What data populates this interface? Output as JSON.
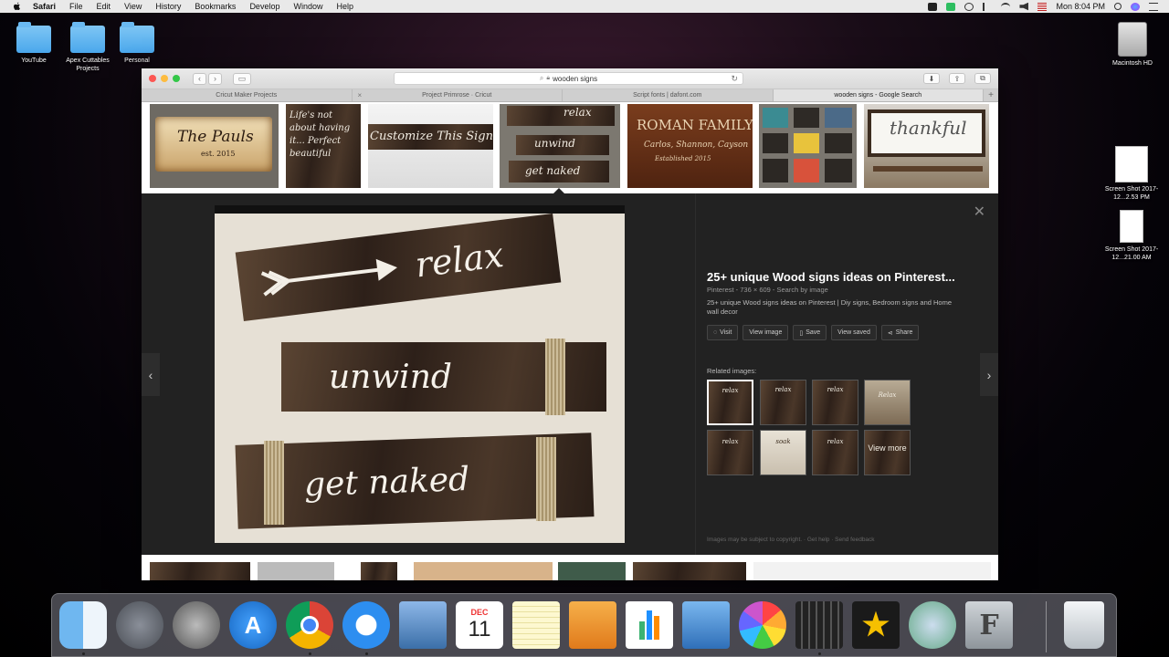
{
  "menubar": {
    "app_name": "Safari",
    "items": [
      "File",
      "Edit",
      "View",
      "History",
      "Bookmarks",
      "Develop",
      "Window",
      "Help"
    ],
    "clock": "Mon 8:04 PM"
  },
  "desktop": {
    "icons_left": [
      {
        "label": "YouTube"
      },
      {
        "label": "Apex Cuttables Projects"
      },
      {
        "label": "Personal"
      }
    ],
    "hd_label": "Macintosh HD",
    "screenshots": [
      {
        "label": "Screen Shot 2017-12...2.53 PM"
      },
      {
        "label": "Screen Shot 2017-12...21.00 AM"
      }
    ]
  },
  "browser": {
    "address": "wooden signs",
    "tabs": [
      {
        "label": "Cricut Maker Projects"
      },
      {
        "label": "Project Primrose · Cricut"
      },
      {
        "label": "Script fonts | dafont.com"
      },
      {
        "label": "wooden signs - Google Search"
      }
    ]
  },
  "thumbs": {
    "t1_line1": "The Pauls",
    "t1_line2": "est. 2015",
    "t2": "Life's not about having it... Perfect beautiful",
    "t3": "Customize This Sign",
    "t4_a": "relax",
    "t4_b": "unwind",
    "t4_c": "get naked",
    "t5_line1": "ROMAN FAMILY",
    "t5_line2": "Carlos, Shannon, Cayson",
    "t5_line3": "Established 2015",
    "t7": "thankful"
  },
  "main_image": {
    "line1": "relax",
    "line2": "unwind",
    "line3": "get naked"
  },
  "result": {
    "title": "25+ unique Wood signs ideas on Pinterest...",
    "meta": "Pinterest - 736 × 609 - Search by image",
    "description": "25+ unique Wood signs ideas on Pinterest | Diy signs, Bedroom signs and Home wall decor",
    "actions": [
      "Visit",
      "View image",
      "Save",
      "View saved",
      "Share"
    ],
    "related_label": "Related images:",
    "related": [
      {
        "t": "relax"
      },
      {
        "t": "relax"
      },
      {
        "t": "relax"
      },
      {
        "t": "Relax"
      },
      {
        "t": "relax"
      },
      {
        "t": "soak"
      },
      {
        "t": "relax"
      },
      {
        "t": "View more"
      }
    ],
    "footer": "Images may be subject to copyright. · Get help · Send feedback"
  },
  "dock": {
    "calendar_month": "DEC",
    "calendar_day": "11"
  }
}
